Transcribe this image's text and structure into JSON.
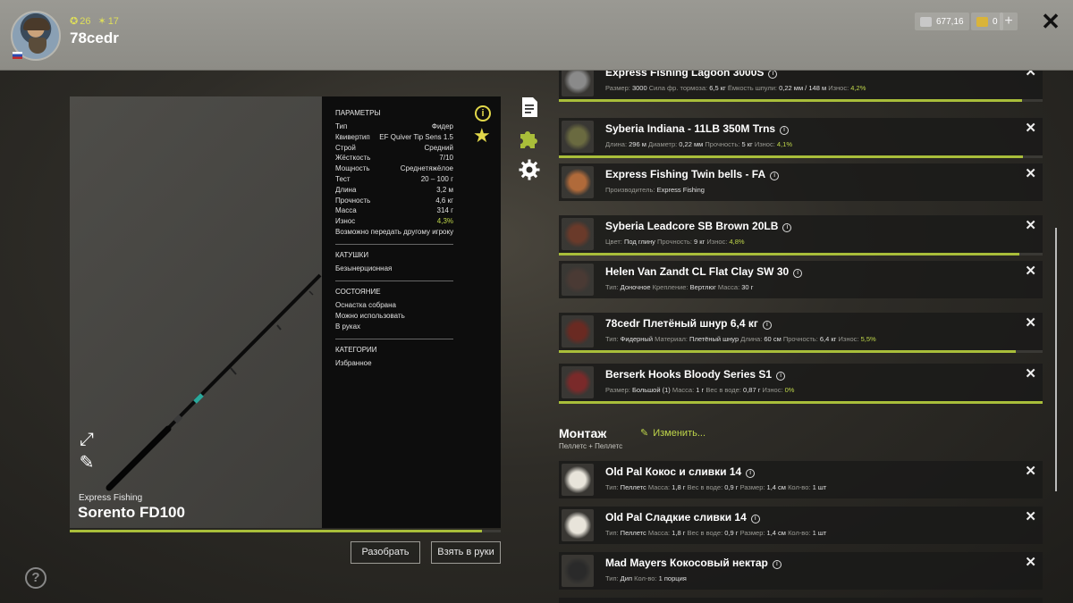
{
  "player": {
    "name": "78cedr",
    "level": "26",
    "stars": "17"
  },
  "currency": {
    "silver": "677,16",
    "gold": "0"
  },
  "rod": {
    "brand": "Express Fishing",
    "name": "Sorento FD100",
    "params_title": "ПАРАМЕТРЫ",
    "params": [
      {
        "k": "Тип",
        "v": "Фидер"
      },
      {
        "k": "Квивертип",
        "v": "EF Quiver Tip Sens 1.5"
      },
      {
        "k": "Строй",
        "v": "Средний"
      },
      {
        "k": "Жёсткость",
        "v": "7/10"
      },
      {
        "k": "Мощность",
        "v": "Среднетяжёлое"
      },
      {
        "k": "Тест",
        "v": "20 – 100 г"
      },
      {
        "k": "Длина",
        "v": "3,2 м"
      },
      {
        "k": "Прочность",
        "v": "4,6 кг"
      },
      {
        "k": "Масса",
        "v": "314 г"
      },
      {
        "k": "Износ",
        "v": "4,3%"
      }
    ],
    "transfer_note": "Возможно передать другому игроку",
    "reels_title": "КАТУШКИ",
    "reels_value": "Безынерционная",
    "state_title": "СОСТОЯНИЕ",
    "state": [
      "Оснастка собрана",
      "Можно использовать",
      "В руках"
    ],
    "categories_title": "КАТЕГОРИИ",
    "categories_value": "Избранное",
    "wear_fraction": 0.957
  },
  "buttons": {
    "disassemble": "Разобрать",
    "take_in_hands": "Взять в руки",
    "help": "?"
  },
  "tackle": [
    {
      "name": "Express Fishing Lagoon 3000S",
      "details": [
        [
          "Размер:",
          "3000"
        ],
        [
          "Сила фр. тормоза:",
          "6,5 кг"
        ],
        [
          "Ёмкость шпули:",
          "0,22 мм / 148 м"
        ],
        [
          "Износ:",
          "4,2%"
        ]
      ],
      "bar": 0.958
    },
    {
      "name": "Syberia Indiana - 11LB 350M Trns",
      "details": [
        [
          "Длина:",
          "296 м"
        ],
        [
          "Диаметр:",
          "0,22 мм"
        ],
        [
          "Прочность:",
          "5 кг"
        ],
        [
          "Износ:",
          "4,1%"
        ]
      ],
      "bar": 0.959
    },
    {
      "name": "Express Fishing Twin bells - FA",
      "details": [
        [
          "Производитель:",
          "Express Fishing"
        ]
      ],
      "bar": null
    },
    {
      "name": "Syberia Leadcore SB Brown 20LB",
      "details": [
        [
          "Цвет:",
          "Под глину"
        ],
        [
          "Прочность:",
          "9 кг"
        ],
        [
          "Износ:",
          "4,8%"
        ]
      ],
      "bar": 0.952
    },
    {
      "name": "Helen Van Zandt CL Flat Clay SW 30",
      "details": [
        [
          "Тип:",
          "Доночное"
        ],
        [
          "Крепление:",
          "Вертлюг"
        ],
        [
          "Масса:",
          "30 г"
        ]
      ],
      "bar": null
    },
    {
      "name": "78cedr Плетёный шнур 6,4 кг",
      "details": [
        [
          "Тип:",
          "Фидерный"
        ],
        [
          "Материал:",
          "Плетёный шнур"
        ],
        [
          "Длина:",
          "60 см"
        ],
        [
          "Прочность:",
          "6,4 кг"
        ],
        [
          "Износ:",
          "5,5%"
        ]
      ],
      "bar": 0.945
    },
    {
      "name": "Berserk Hooks Bloody Series S1",
      "details": [
        [
          "Размер:",
          "Большой (1)"
        ],
        [
          "Масса:",
          "1 г"
        ],
        [
          "Вес в воде:",
          "0,87 г"
        ],
        [
          "Износ:",
          "0%"
        ]
      ],
      "bar": 1.0
    }
  ],
  "montazh": {
    "title": "Монтаж",
    "subtitle": "Пеллетс + Пеллетс",
    "edit_label": "Изменить..."
  },
  "baits": [
    {
      "name": "Old Pal Кокос и сливки 14",
      "details": [
        [
          "Тип:",
          "Пеллетс"
        ],
        [
          "Масса:",
          "1,8 г"
        ],
        [
          "Вес в воде:",
          "0,9 г"
        ],
        [
          "Размер:",
          "1,4 см"
        ],
        [
          "Кол-во:",
          "1 шт"
        ]
      ]
    },
    {
      "name": "Old Pal Сладкие сливки 14",
      "details": [
        [
          "Тип:",
          "Пеллетс"
        ],
        [
          "Масса:",
          "1,8 г"
        ],
        [
          "Вес в воде:",
          "0,9 г"
        ],
        [
          "Размер:",
          "1,4 см"
        ],
        [
          "Кол-во:",
          "1 шт"
        ]
      ]
    },
    {
      "name": "Mad Mayers Кокосовый нектар",
      "details": [
        [
          "Тип:",
          "Дип"
        ],
        [
          "Кол-во:",
          "1 порция"
        ]
      ]
    }
  ],
  "colors": {
    "accent_green": "#a9be3a",
    "accent_yellow": "#e2d84a",
    "wear_green": "#bfd64a"
  }
}
